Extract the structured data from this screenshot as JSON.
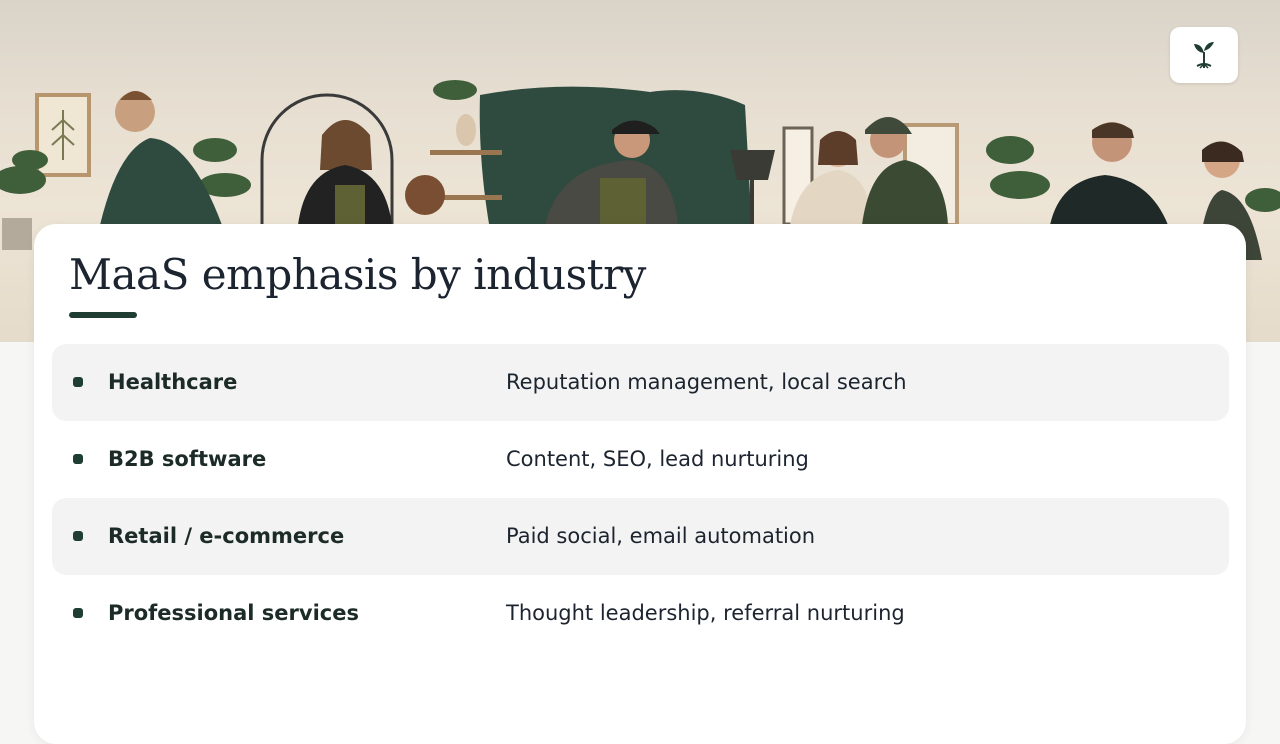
{
  "slide": {
    "title": "MaaS emphasis by industry"
  },
  "logo": {
    "icon": "sprout-icon",
    "color": "#1f3d32"
  },
  "hero": {
    "icon": "team-working-illustration"
  },
  "rows": [
    {
      "industry": "Healthcare",
      "emphasis": "Reputation management, local search"
    },
    {
      "industry": "B2B software",
      "emphasis": "Content, SEO, lead nurturing"
    },
    {
      "industry": "Retail / e-commerce",
      "emphasis": "Paid social, email automation"
    },
    {
      "industry": "Professional services",
      "emphasis": "Thought leadership, referral nurturing"
    }
  ],
  "colors": {
    "accent": "#1f3d32",
    "row_shade": "#f2f3f2",
    "text": "#1c2430"
  }
}
